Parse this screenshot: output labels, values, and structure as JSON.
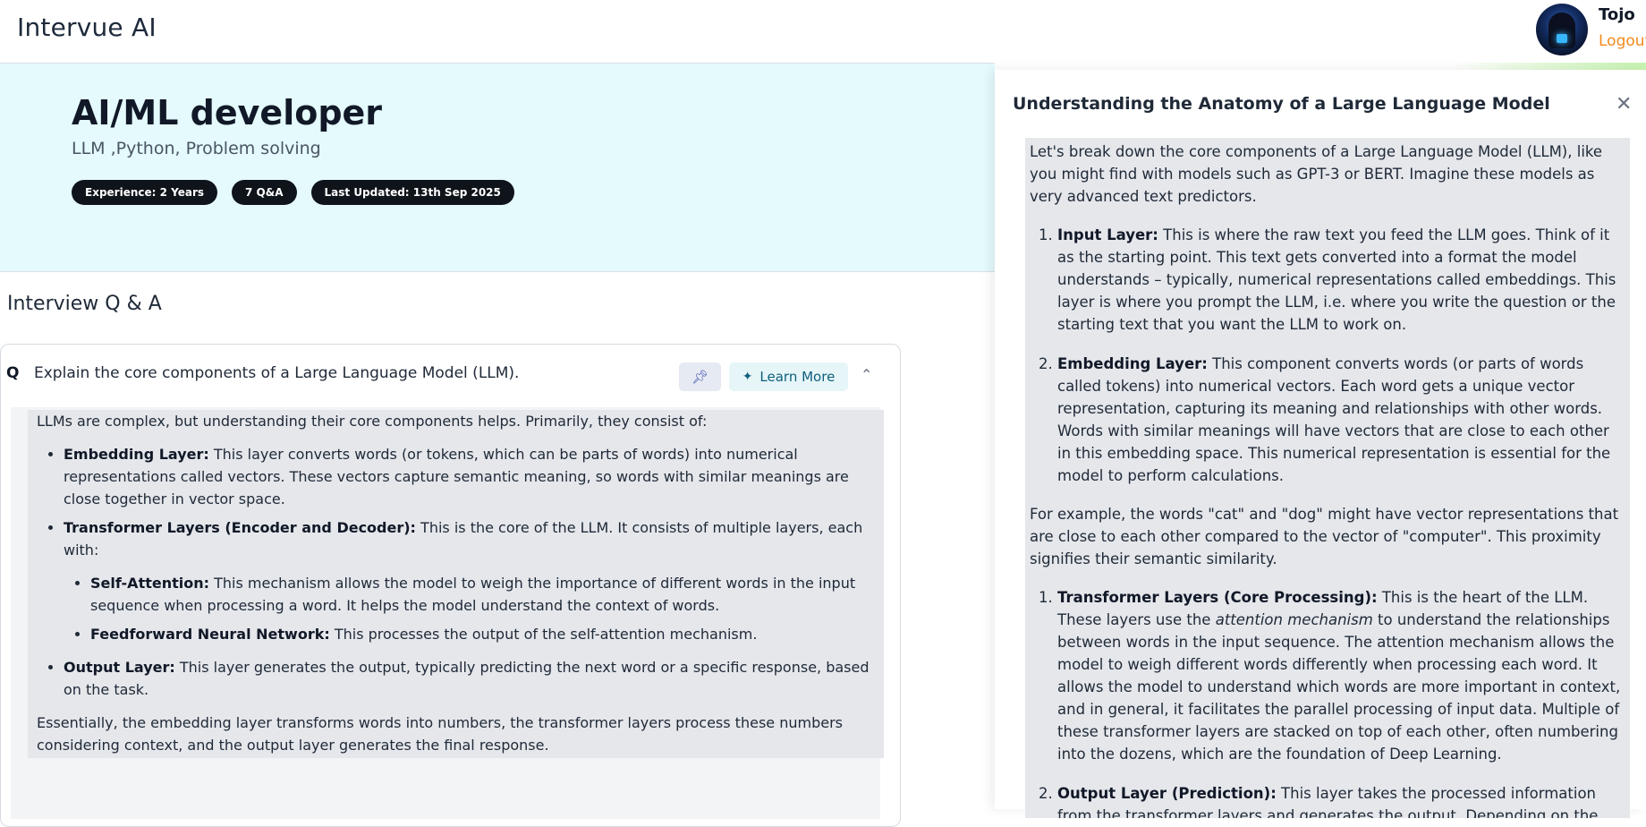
{
  "header": {
    "app_title": "Intervue AI",
    "user_name": "Tojo",
    "logout_label": "Logout"
  },
  "hero": {
    "role_title": "AI/ML developer",
    "skills": "LLM ,Python, Problem solving",
    "badges": [
      "Experience: 2 Years",
      "7 Q&A",
      "Last Updated: 13th Sep 2025"
    ]
  },
  "qa_section": {
    "title": "Interview Q & A",
    "question_letter": "Q",
    "question": "Explain the core components of a Large Language Model (LLM).",
    "learn_more_label": "Learn More",
    "answer": {
      "intro": "LLMs are complex, but understanding their core components helps. Primarily, they consist of:",
      "items": [
        {
          "term": "Embedding Layer:",
          "text": " This layer converts words (or tokens, which can be parts of words) into numerical representations called vectors. These vectors capture semantic meaning, so words with similar meanings are close together in vector space."
        },
        {
          "term": "Transformer Layers (Encoder and Decoder):",
          "text": " This is the core of the LLM. It consists of multiple layers, each with:"
        }
      ],
      "subitems": [
        {
          "term": "Self-Attention:",
          "text": " This mechanism allows the model to weigh the importance of different words in the input sequence when processing a word. It helps the model understand the context of words."
        },
        {
          "term": "Feedforward Neural Network:",
          "text": " This processes the output of the self-attention mechanism."
        }
      ],
      "last_item": {
        "term": "Output Layer:",
        "text": " This layer generates the output, typically predicting the next word or a specific response, based on the task."
      },
      "conclusion": "Essentially, the embedding layer transforms words into numbers, the transformer layers process these numbers considering context, and the output layer generates the final response."
    }
  },
  "drawer": {
    "title": "Understanding the Anatomy of a Large Language Model",
    "intro": "Let's break down the core components of a Large Language Model (LLM), like you might find with models such as GPT-3 or BERT. Imagine these models as very advanced text predictors.",
    "list1": [
      {
        "term": "Input Layer:",
        "text": " This is where the raw text you feed the LLM goes. Think of it as the starting point. This text gets converted into a format the model understands – typically, numerical representations called embeddings. This layer is where you prompt the LLM, i.e. where you write the question or the starting text that you want the LLM to work on."
      },
      {
        "term": "Embedding Layer:",
        "text": " This component converts words (or parts of words called tokens) into numerical vectors. Each word gets a unique vector representation, capturing its meaning and relationships with other words. Words with similar meanings will have vectors that are close to each other in this embedding space. This numerical representation is essential for the model to perform calculations."
      }
    ],
    "example": "For example, the words \"cat\" and \"dog\" might have vector representations that are close to each other compared to the vector of \"computer\". This proximity signifies their semantic similarity.",
    "list2_item1": {
      "term": "Transformer Layers (Core Processing):",
      "text_a": " This is the heart of the LLM. These layers use the ",
      "italic": "attention mechanism",
      "text_b": " to understand the relationships between words in the input sequence. The attention mechanism allows the model to weigh different words differently when processing each word. It allows the model to understand which words are more important in context, and in general, it facilitates the parallel processing of input data. Multiple of these transformer layers are stacked on top of each other, often numbering into the dozens, which are the foundation of Deep Learning."
    },
    "list2_item2": {
      "term": "Output Layer (Prediction):",
      "text": " This layer takes the processed information from the transformer layers and generates the output. Depending on the task, the output"
    }
  },
  "icons": {
    "pin": "pin-icon",
    "sparkle": "sparkle-icon",
    "chevron": "chevron-up-icon",
    "close": "close-icon"
  },
  "colors": {
    "hero_bg": "#e4fafc",
    "logout": "#f28a1c",
    "badge_bg": "#0f141a",
    "learn_more": "#0f5e7d"
  }
}
